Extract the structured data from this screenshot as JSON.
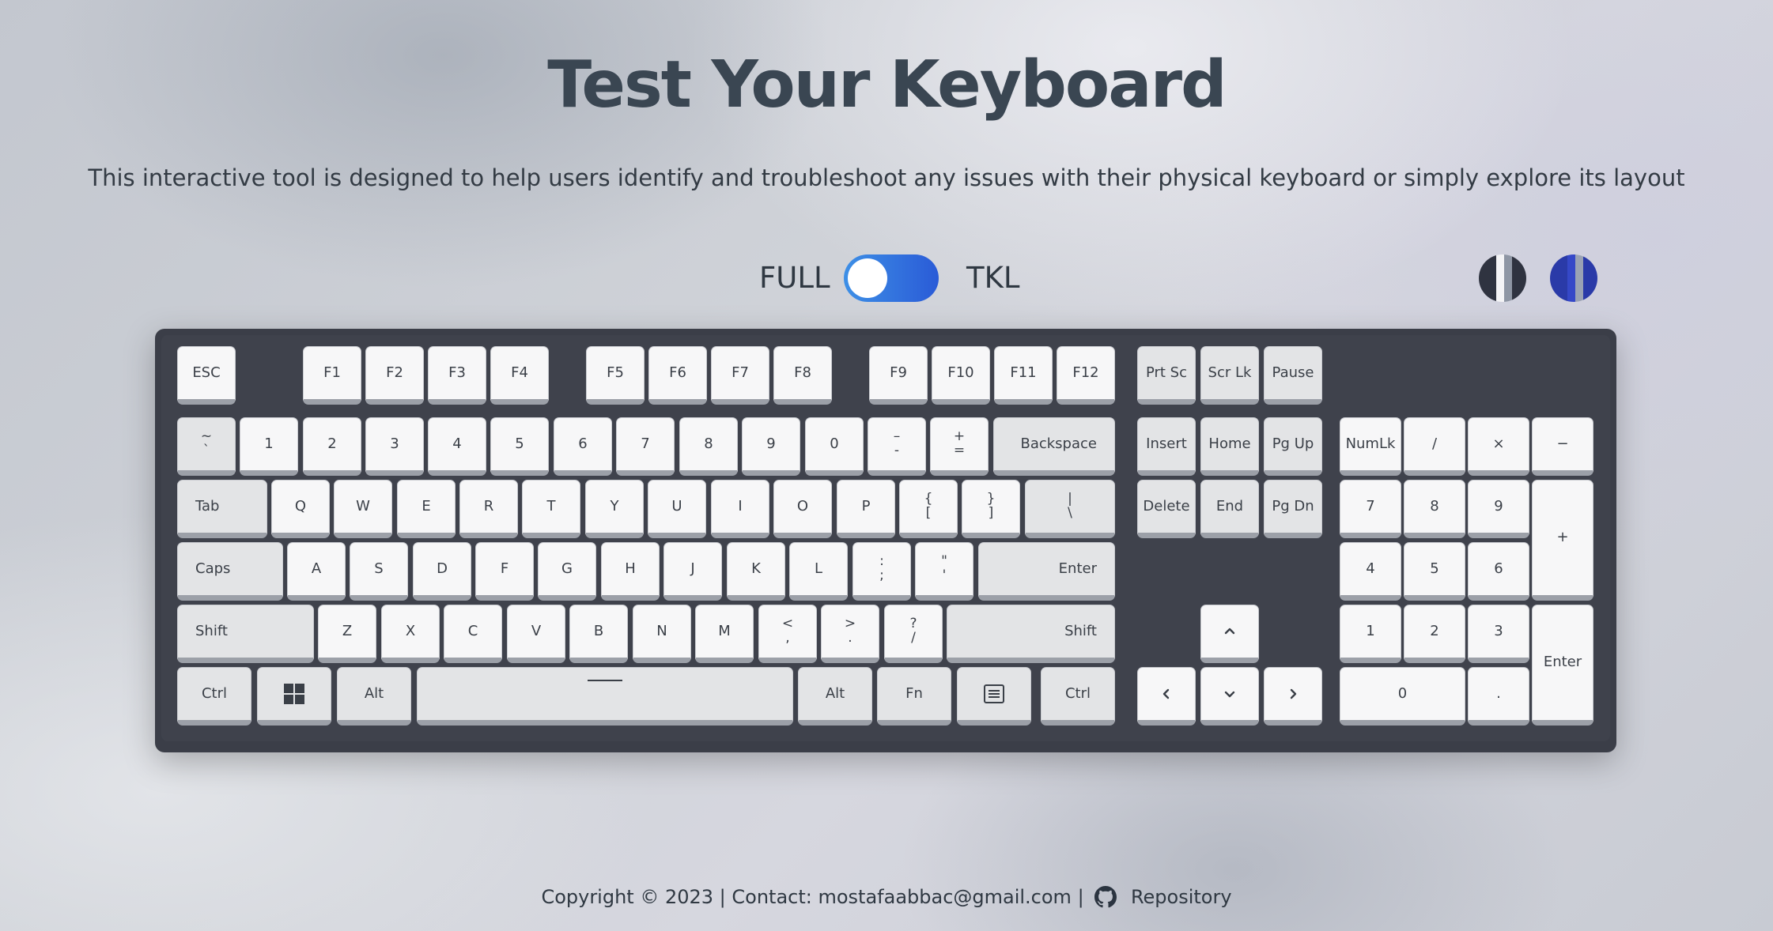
{
  "header": {
    "title": "Test Your Keyboard",
    "subtitle": "This interactive tool is designed to help users identify and troubleshoot any issues with their physical keyboard or simply explore its layout"
  },
  "layout_switch": {
    "left_label": "FULL",
    "right_label": "TKL",
    "state": "FULL"
  },
  "themes": [
    {
      "name": "dark-theme",
      "colors": [
        "#2f3340",
        "#f4f4f6",
        "#8e96a4",
        "#2f3340"
      ]
    },
    {
      "name": "blue-theme",
      "colors": [
        "#2a3aa8",
        "#3548c8",
        "#9aa2b4",
        "#2a3aa8"
      ]
    }
  ],
  "keys": {
    "esc": "ESC",
    "f1": "F1",
    "f2": "F2",
    "f3": "F3",
    "f4": "F4",
    "f5": "F5",
    "f6": "F6",
    "f7": "F7",
    "f8": "F8",
    "f9": "F9",
    "f10": "F10",
    "f11": "F11",
    "f12": "F12",
    "prtsc": "Prt Sc",
    "scrlk": "Scr Lk",
    "pause": "Pause",
    "tilde_top": "~",
    "tilde_bottom": "`",
    "n1": "1",
    "n2": "2",
    "n3": "3",
    "n4": "4",
    "n5": "5",
    "n6": "6",
    "n7": "7",
    "n8": "8",
    "n9": "9",
    "n0": "0",
    "minus_top": "–",
    "minus_bottom": "-",
    "equal_top": "+",
    "equal_bottom": "=",
    "backspace": "Backspace",
    "insert": "Insert",
    "home": "Home",
    "pgup": "Pg Up",
    "numlk": "NumLk",
    "num_div": "/",
    "num_mul": "×",
    "num_sub": "−",
    "tab": "Tab",
    "q": "Q",
    "w": "W",
    "e": "E",
    "r": "R",
    "t": "T",
    "y": "Y",
    "u": "U",
    "i": "I",
    "o": "O",
    "p": "P",
    "lbrace_top": "{",
    "lbrace_bottom": "[",
    "rbrace_top": "}",
    "rbrace_bottom": "]",
    "pipe_top": "|",
    "pipe_bottom": "\\",
    "delete": "Delete",
    "end": "End",
    "pgdn": "Pg Dn",
    "num7": "7",
    "num8": "8",
    "num9": "9",
    "num_add": "+",
    "caps": "Caps",
    "a": "A",
    "s": "S",
    "d": "D",
    "f": "F",
    "g": "G",
    "h": "H",
    "j": "J",
    "k": "K",
    "l": "L",
    "semi_top": ":",
    "semi_bottom": ";",
    "quote_top": "\"",
    "quote_bottom": "'",
    "enter": "Enter",
    "num4": "4",
    "num5": "5",
    "num6": "6",
    "lshift": "Shift",
    "z": "Z",
    "x": "X",
    "c": "C",
    "v": "V",
    "b": "B",
    "n": "N",
    "m": "M",
    "comma_top": "<",
    "comma_bottom": ",",
    "period_top": ">",
    "period_bottom": ".",
    "slash_top": "?",
    "slash_bottom": "/",
    "rshift": "Shift",
    "num1": "1",
    "num2": "2",
    "num3": "3",
    "num_enter": "Enter",
    "lctrl": "Ctrl",
    "lalt": "Alt",
    "ralt": "Alt",
    "fn": "Fn",
    "rctrl": "Ctrl",
    "num0": "0",
    "num_dot": "."
  },
  "icons": {
    "windows": "windows-icon",
    "menu": "menu-icon",
    "space": "spacebar-line-icon",
    "up": "chevron-up-icon",
    "down": "chevron-down-icon",
    "left": "chevron-left-icon",
    "right": "chevron-right-icon",
    "github": "github-icon"
  },
  "footer": {
    "copyright": "Copyright © 2023 | Contact: mostafaabbac@gmail.com |",
    "repo_label": "Repository"
  }
}
